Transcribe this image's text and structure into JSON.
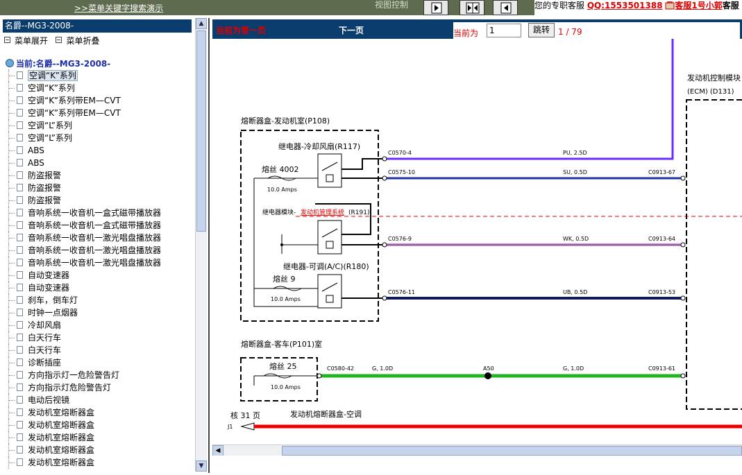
{
  "topbar": {
    "search_demo_link": ">>菜单关键字搜索演示",
    "view_control_label": "视图控制",
    "service_text": "您的专职客服",
    "qq": "QQ:1553501388",
    "cs_name": "客服1号小郭",
    "cs_more": "客服"
  },
  "left": {
    "title": "名爵--MG3-2008-",
    "expand_label": "菜单展开",
    "collapse_label": "菜单折叠",
    "current_label": "当前:名爵--MG3-2008-",
    "items": [
      "空调“K”系列",
      "空调“K”系列",
      "空调“K”系列带EM—CVT",
      "空调“K”系列带EM—CVT",
      "空调“L”系列",
      "空调“L”系列",
      "ABS",
      "ABS",
      "防盗报警",
      "防盗报警",
      "防盗报警",
      "音响系统一收音机一盒式磁带播放器",
      "音响系统一收音机一盒式磁带播放器",
      "音响系统一收音机一激光唱盘播放器",
      "音响系统一收音机一激光唱盘播放器",
      "音响系统一收音机一激光唱盘播放器",
      "自动变速器",
      "自动变速器",
      "刹车，倒车灯",
      "时钟一点烟器",
      "冷却风扇",
      "白天行车",
      "白天行车",
      "诊断插座",
      "方向指示灯一危险警告灯",
      "方向指示灯危险警告灯",
      "电动后视镜",
      "发动机室熔断器盒",
      "发动机室熔断器盒",
      "发动机室熔断器盒",
      "发动机室熔断器盒",
      "发动机室熔断器盒"
    ]
  },
  "nav": {
    "first_page": "当前为第一页",
    "next_page": "下一页",
    "current_label": "当前为",
    "page_value": "1",
    "go_button": "跳转",
    "total": "1 / 79"
  },
  "diagram": {
    "ecm_title": "发动机控制模块",
    "ecm_code": "(ECM) (D131)",
    "fusebox_engine": "熔断器盒-发动机室(P108)",
    "relay_fan": "继电器-冷却风扇(R117)",
    "fuse_4002": "熔丝 4002",
    "fuse_4002_amps": "10.0 Amps",
    "relay_module_prefix": "继电器模块-",
    "relay_module_link": "发动机管理系统",
    "relay_module_suffix": "(R191)",
    "relay_ac": "继电器-可调(A/C)(R180)",
    "fuse_9": "熔丝 9",
    "fuse_9_amps": "10.0 Amps",
    "fusebox_passenger": "熔断器盒-客车(P101)室",
    "fuse_25": "熔丝 25",
    "fuse_25_amps": "10.0 Amps",
    "ref_page": "核 31 页",
    "ref_j": "J1",
    "bottom_label": "发动机熔断器盒-空调",
    "wires": [
      {
        "from": "C0570-4",
        "spec": "PU, 2.5D",
        "to": "",
        "color": "#7a3cff"
      },
      {
        "from": "C0575-10",
        "spec": "SU, 0.5D",
        "to": "C0913-67",
        "color": "#2233aa"
      },
      {
        "from": "C0576-9",
        "spec": "WK, 0.5D",
        "to": "C0913-64",
        "color": "#d68be6"
      },
      {
        "from": "C0576-11",
        "spec": "UB, 0.5D",
        "to": "C0913-53",
        "color": "#0e1a5c"
      },
      {
        "from": "C0580-42",
        "spec": "G, 1.0D",
        "mid": "A50",
        "spec2": "G, 1.0D",
        "to": "C0913-61",
        "color": "#22b522"
      }
    ]
  }
}
